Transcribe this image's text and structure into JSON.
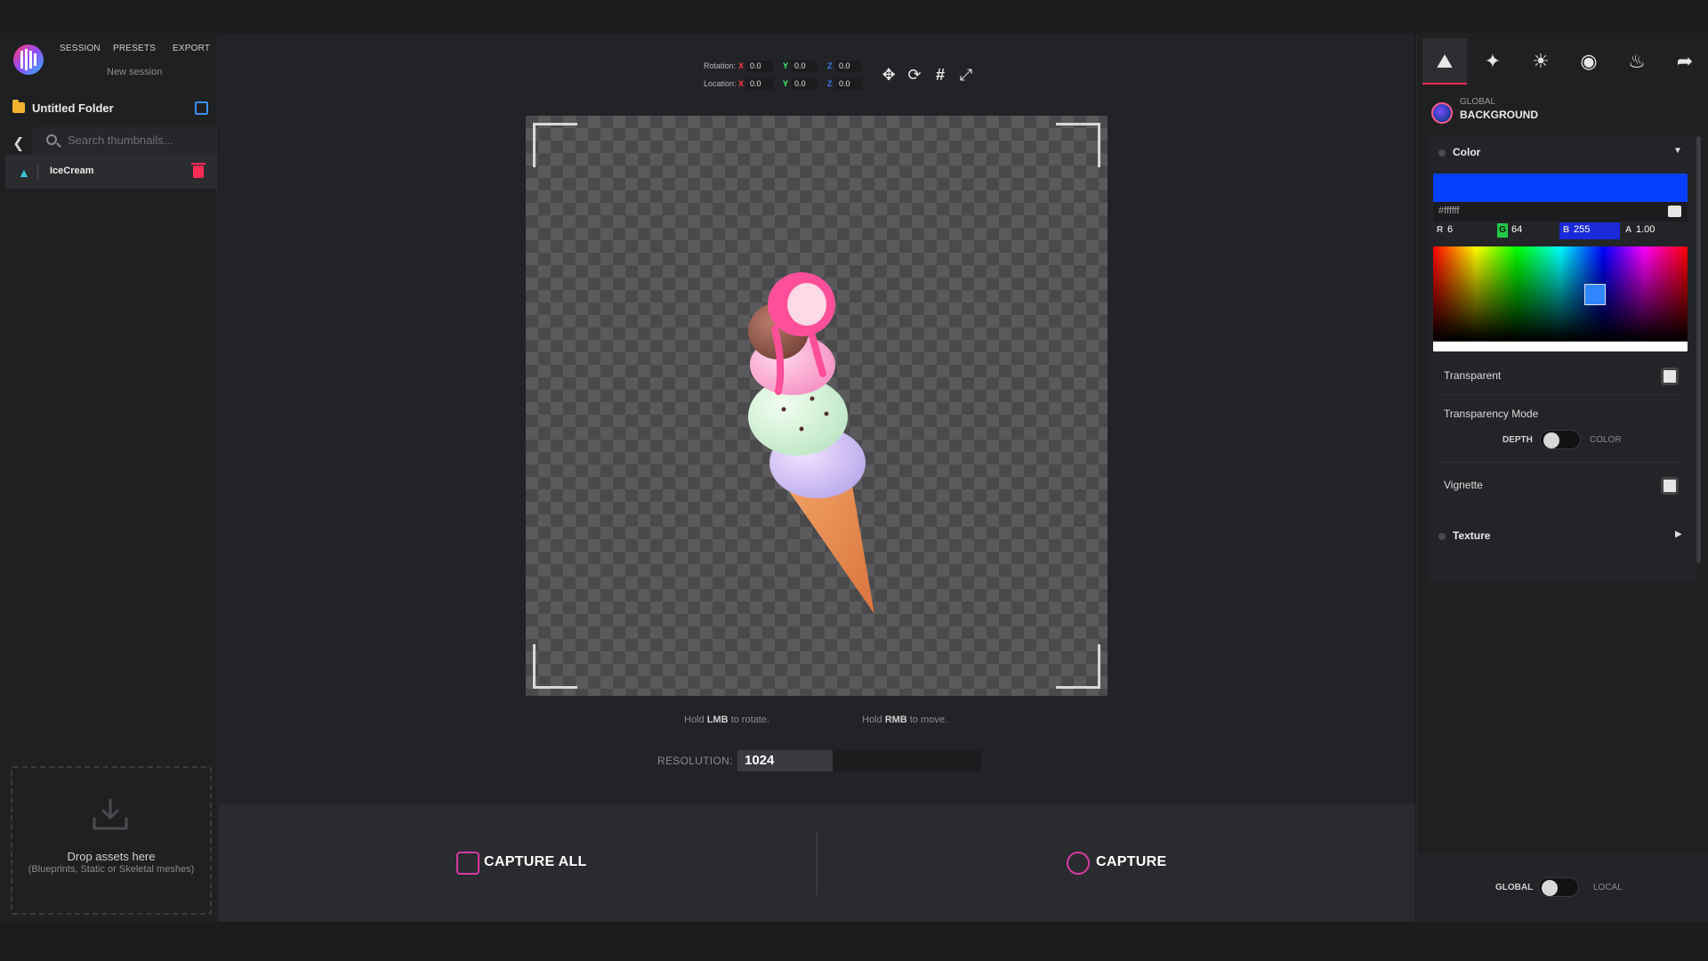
{
  "nav": {
    "session": "SESSION",
    "presets": "PRESETS",
    "export": "EXPORT",
    "subtitle": "New session"
  },
  "folder": {
    "name": "Untitled Folder"
  },
  "search": {
    "placeholder": "Search thumbnails..."
  },
  "assets": [
    {
      "name": "IceCream"
    }
  ],
  "drop": {
    "title": "Drop assets here",
    "subtitle": "(Blueprints, Static or Skeletal meshes)"
  },
  "transform": {
    "rotation_label": "Rotation:",
    "location_label": "Location:",
    "rotation": {
      "x": "0.0",
      "y": "0.0",
      "z": "0.0"
    },
    "location": {
      "x": "0.0",
      "y": "0.0",
      "z": "0.0"
    },
    "axis_x": "X",
    "axis_y": "Y",
    "axis_z": "Z"
  },
  "hints": {
    "rotate_pre": "Hold ",
    "rotate_key": "LMB",
    "rotate_post": " to rotate.",
    "move_pre": "Hold ",
    "move_key": "RMB",
    "move_post": " to move."
  },
  "resolution": {
    "label": "RESOLUTION:",
    "value": "1024",
    "fill_fraction": 0.39
  },
  "capture": {
    "all_label": "CAPTURE ALL",
    "single_label": "CAPTURE"
  },
  "right": {
    "global_label": "GLOBAL",
    "section_title": "BACKGROUND",
    "color": {
      "title": "Color",
      "swatch": "#0640ff",
      "hex": "#ffffff",
      "r_label": "R",
      "r": "6",
      "g_label": "G",
      "g": "64",
      "b_label": "B",
      "b": "255",
      "a_label": "A",
      "a": "1.00"
    },
    "transparent_label": "Transparent",
    "transparency_mode_label": "Transparency Mode",
    "mode_left": "DEPTH",
    "mode_right": "COLOR",
    "vignette_label": "Vignette",
    "texture_title": "Texture",
    "scope_left": "GLOBAL",
    "scope_right": "LOCAL"
  },
  "colors": {
    "accent_pink": "#ff2a55",
    "accent_blue": "#3d8ff5",
    "panel": "#1f2022",
    "viewport": "#222326"
  }
}
